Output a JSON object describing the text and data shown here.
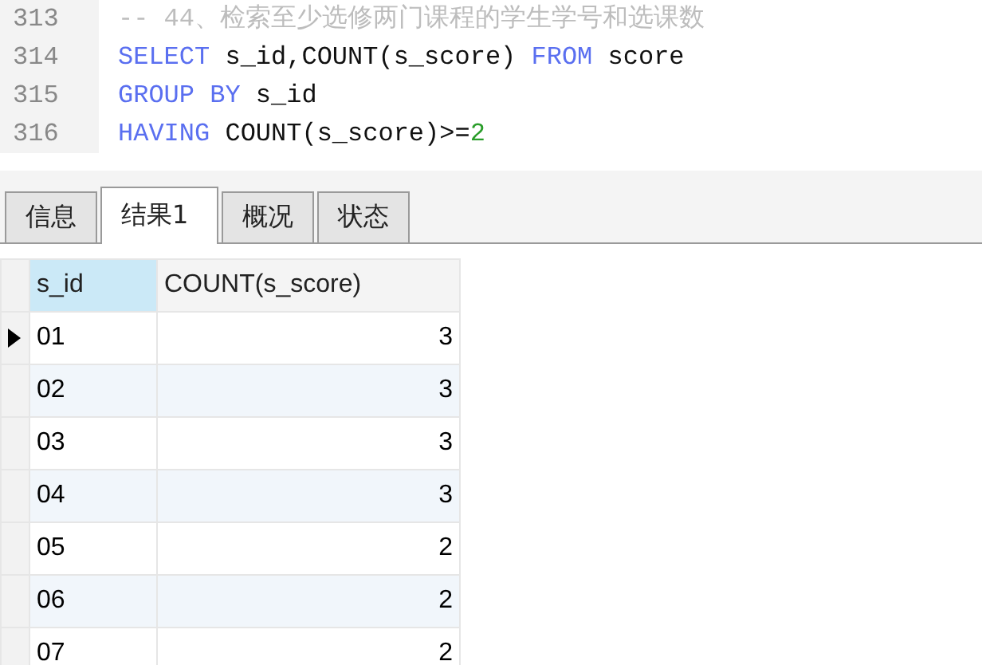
{
  "editor": {
    "lines": [
      {
        "number": "313",
        "tokens": [
          {
            "kind": "comment",
            "text": "-- 44、检索至少选修两门课程的学生学号和选课数"
          }
        ]
      },
      {
        "number": "314",
        "tokens": [
          {
            "kind": "keyword",
            "text": "SELECT"
          },
          {
            "kind": "plain",
            "text": " s_id,COUNT(s_score) "
          },
          {
            "kind": "keyword",
            "text": "FROM"
          },
          {
            "kind": "plain",
            "text": " score"
          }
        ]
      },
      {
        "number": "315",
        "tokens": [
          {
            "kind": "keyword",
            "text": "GROUP BY"
          },
          {
            "kind": "plain",
            "text": " s_id"
          }
        ]
      },
      {
        "number": "316",
        "tokens": [
          {
            "kind": "keyword",
            "text": "HAVING"
          },
          {
            "kind": "plain",
            "text": " COUNT(s_score)>="
          },
          {
            "kind": "number",
            "text": "2"
          }
        ]
      }
    ]
  },
  "tabs": [
    {
      "label": "信息",
      "selected": false
    },
    {
      "label": "结果1",
      "selected": true
    },
    {
      "label": "概况",
      "selected": false
    },
    {
      "label": "状态",
      "selected": false
    }
  ],
  "grid": {
    "columns": [
      {
        "label": "s_id",
        "selected": true
      },
      {
        "label": "COUNT(s_score)",
        "selected": false
      }
    ],
    "rows": [
      {
        "current": true,
        "cells": [
          "01",
          "3"
        ]
      },
      {
        "current": false,
        "cells": [
          "02",
          "3"
        ]
      },
      {
        "current": false,
        "cells": [
          "03",
          "3"
        ]
      },
      {
        "current": false,
        "cells": [
          "04",
          "3"
        ]
      },
      {
        "current": false,
        "cells": [
          "05",
          "2"
        ]
      },
      {
        "current": false,
        "cells": [
          "06",
          "2"
        ]
      },
      {
        "current": false,
        "cells": [
          "07",
          "2"
        ]
      }
    ]
  }
}
